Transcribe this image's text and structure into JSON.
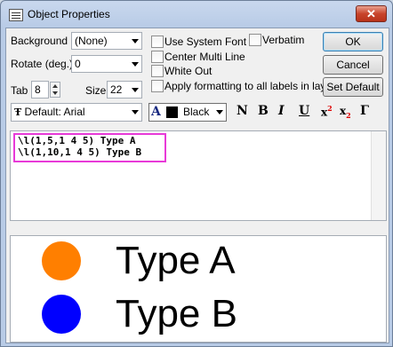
{
  "window": {
    "title": "Object Properties",
    "close": "✕"
  },
  "left": {
    "background_label": "Background",
    "background_value": "(None)",
    "rotate_label": "Rotate (deg.)",
    "rotate_value": "0",
    "tab_label": "Tab",
    "tab_value": "8",
    "size_label": "Size",
    "size_value": "22"
  },
  "options": {
    "use_system_font": "Use System Font",
    "verbatim": "Verbatim",
    "center_multi_line": "Center Multi Line",
    "white_out": "White Out",
    "apply_all": "Apply formatting to all labels in layer"
  },
  "buttons": {
    "ok": "OK",
    "cancel": "Cancel",
    "set_default": "Set Default"
  },
  "format": {
    "font_prefix": "Ŧ",
    "font_value": "Default: Arial",
    "color_glyph": "A",
    "color_name": "Black",
    "color_hex": "#000000",
    "normal": "N",
    "bold": "B",
    "italic": "I",
    "underline": "U",
    "superscript": "x",
    "superscript_mark": "2",
    "subscript": "x",
    "subscript_mark": "2",
    "greek": "Γ"
  },
  "editor": {
    "line1": "\\l(1,5,1 4 5) Type A",
    "line2": "\\l(1,10,1 4 5) Type B"
  },
  "preview": {
    "items": [
      {
        "label": "Type A",
        "color": "#ff7f00"
      },
      {
        "label": "Type B",
        "color": "#0000ff"
      }
    ]
  }
}
